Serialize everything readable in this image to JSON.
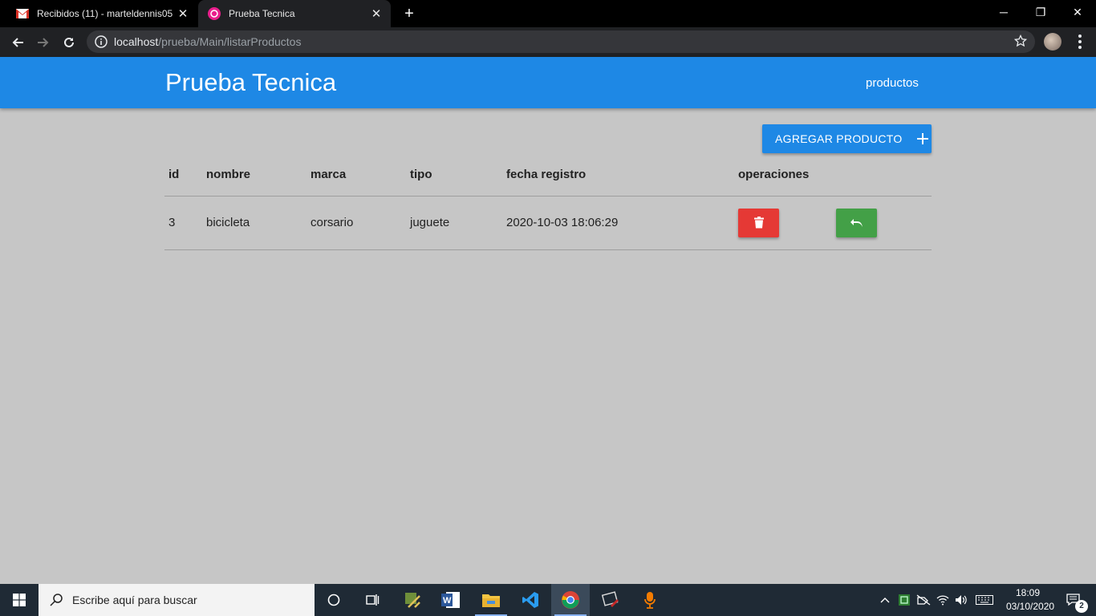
{
  "browser": {
    "tabs": [
      {
        "title": "Recibidos (11) - marteldennis05@",
        "icon": "gmail-icon"
      },
      {
        "title": "Prueba Tecnica",
        "icon": "app-favicon"
      }
    ],
    "url_host": "localhost",
    "url_path": "/prueba/Main/listarProductos"
  },
  "app": {
    "brand": "Prueba Tecnica",
    "nav_link": "productos",
    "add_button": "AGREGAR PRODUCTO",
    "accent_color": "#1e88e5"
  },
  "table": {
    "headers": [
      "id",
      "nombre",
      "marca",
      "tipo",
      "fecha registro",
      "operaciones"
    ],
    "rows": [
      {
        "id": "3",
        "nombre": "bicicleta",
        "marca": "corsario",
        "tipo": "juguete",
        "fecha": "2020-10-03 18:06:29"
      }
    ],
    "delete_color": "#e53935",
    "restore_color": "#43a047"
  },
  "taskbar": {
    "search_placeholder": "Escribe aquí para buscar",
    "time": "18:09",
    "date": "03/10/2020",
    "notifications": "2"
  }
}
